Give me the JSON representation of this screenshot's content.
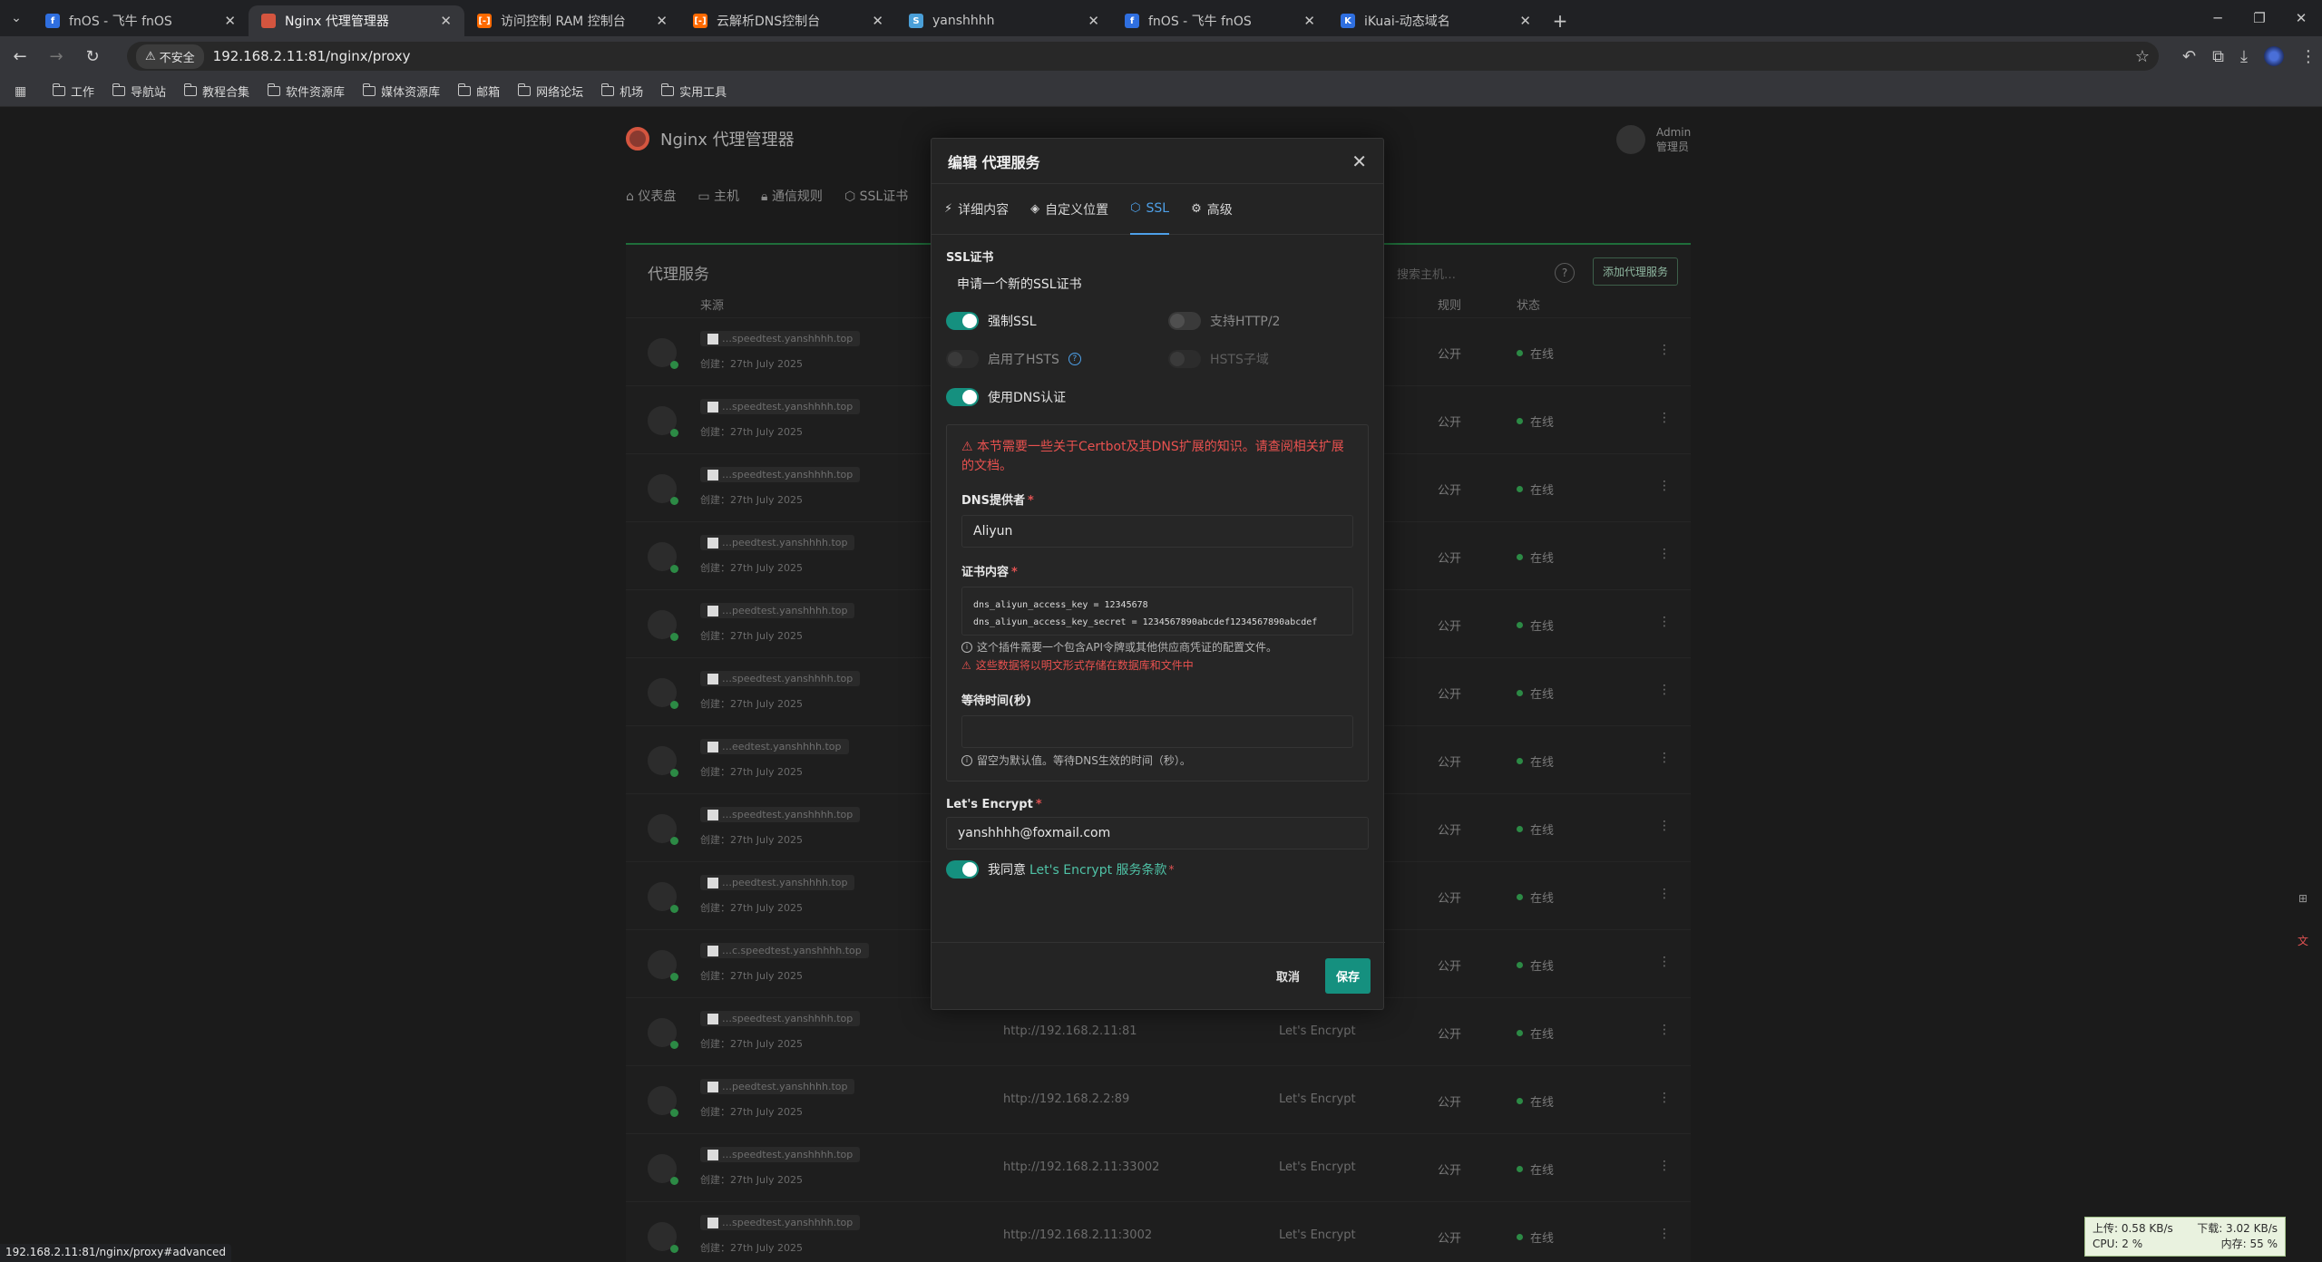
{
  "browser": {
    "tabs": [
      {
        "title": "fnOS - 飞牛 fnOS",
        "fav_color": "#2f6fe0",
        "fav": "f",
        "active": false
      },
      {
        "title": "Nginx 代理管理器",
        "fav_color": "#d4553f",
        "fav": "",
        "active": true
      },
      {
        "title": "访问控制 RAM 控制台",
        "fav_color": "#ff6a00",
        "fav": "[-]",
        "active": false
      },
      {
        "title": "云解析DNS控制台",
        "fav_color": "#ff6a00",
        "fav": "[-]",
        "active": false
      },
      {
        "title": "yanshhhh",
        "fav_color": "#4a9fd8",
        "fav": "S",
        "active": false
      },
      {
        "title": "fnOS - 飞牛 fnOS",
        "fav_color": "#2f6fe0",
        "fav": "f",
        "active": false
      },
      {
        "title": "iKuai-动态域名",
        "fav_color": "#2f6fe0",
        "fav": "K",
        "active": false
      }
    ],
    "insecure_label": "不安全",
    "url": "192.168.2.11:81/nginx/proxy",
    "bookmarks": [
      "工作",
      "导航站",
      "教程合集",
      "软件资源库",
      "媒体资源库",
      "邮箱",
      "网络论坛",
      "机场",
      "实用工具"
    ],
    "status_url": "192.168.2.11:81/nginx/proxy#advanced"
  },
  "app": {
    "title": "Nginx 代理管理器",
    "admin_name": "Admin",
    "admin_role": "管理员",
    "nav": [
      "仪表盘",
      "主机",
      "通信规则",
      "SSL证书"
    ],
    "card_title": "代理服务",
    "search_placeholder": "搜索主机…",
    "add_button": "添加代理服务",
    "col_source": "来源",
    "col_rule": "规则",
    "col_status": "状态"
  },
  "rows": [
    {
      "host": "…speedtest.yanshhhh.top",
      "created": "创建：27th July 2025",
      "dest": "",
      "ssl": "",
      "rule": "公开",
      "status": "在线"
    },
    {
      "host": "…speedtest.yanshhhh.top",
      "created": "创建：27th July 2025",
      "dest": "",
      "ssl": "",
      "rule": "公开",
      "status": "在线"
    },
    {
      "host": "…speedtest.yanshhhh.top",
      "created": "创建：27th July 2025",
      "dest": "",
      "ssl": "",
      "rule": "公开",
      "status": "在线"
    },
    {
      "host": "…peedtest.yanshhhh.top",
      "created": "创建：27th July 2025",
      "dest": "",
      "ssl": "",
      "rule": "公开",
      "status": "在线"
    },
    {
      "host": "…peedtest.yanshhhh.top",
      "created": "创建：27th July 2025",
      "dest": "",
      "ssl": "",
      "rule": "公开",
      "status": "在线"
    },
    {
      "host": "…speedtest.yanshhhh.top",
      "created": "创建：27th July 2025",
      "dest": "",
      "ssl": "",
      "rule": "公开",
      "status": "在线"
    },
    {
      "host": "…eedtest.yanshhhh.top",
      "created": "创建：27th July 2025",
      "dest": "",
      "ssl": "",
      "rule": "公开",
      "status": "在线"
    },
    {
      "host": "…speedtest.yanshhhh.top",
      "created": "创建：27th July 2025",
      "dest": "",
      "ssl": "",
      "rule": "公开",
      "status": "在线"
    },
    {
      "host": "…peedtest.yanshhhh.top",
      "created": "创建：27th July 2025",
      "dest": "",
      "ssl": "",
      "rule": "公开",
      "status": "在线"
    },
    {
      "host": "…c.speedtest.yanshhhh.top",
      "created": "创建：27th July 2025",
      "dest": "",
      "ssl": "",
      "rule": "公开",
      "status": "在线"
    },
    {
      "host": "…speedtest.yanshhhh.top",
      "created": "创建：27th July 2025",
      "dest": "http://192.168.2.11:81",
      "ssl": "Let's Encrypt",
      "rule": "公开",
      "status": "在线"
    },
    {
      "host": "…peedtest.yanshhhh.top",
      "created": "创建：27th July 2025",
      "dest": "http://192.168.2.2:89",
      "ssl": "Let's Encrypt",
      "rule": "公开",
      "status": "在线"
    },
    {
      "host": "…speedtest.yanshhhh.top",
      "created": "创建：27th July 2025",
      "dest": "http://192.168.2.11:33002",
      "ssl": "Let's Encrypt",
      "rule": "公开",
      "status": "在线"
    },
    {
      "host": "…speedtest.yanshhhh.top",
      "created": "创建：27th July 2025",
      "dest": "http://192.168.2.11:3002",
      "ssl": "Let's Encrypt",
      "rule": "公开",
      "status": "在线"
    }
  ],
  "modal": {
    "title": "编辑 代理服务",
    "tabs": [
      {
        "label": "详细内容",
        "icon": "⚡"
      },
      {
        "label": "自定义位置",
        "icon": "◈"
      },
      {
        "label": "SSL",
        "icon": "⬡"
      },
      {
        "label": "高级",
        "icon": "⚙"
      }
    ],
    "ssl_cert_label": "SSL证书",
    "ssl_cert_value": "申请一个新的SSL证书",
    "force_ssl": "强制SSL",
    "http2": "支持HTTP/2",
    "hsts": "启用了HSTS",
    "hsts_sub": "HSTS子域",
    "dns_challenge": "使用DNS认证",
    "dns_warning": "本节需要一些关于Certbot及其DNS扩展的知识。请查阅相关扩展的文档。",
    "dns_provider_label": "DNS提供者",
    "dns_provider_value": "Aliyun",
    "credentials_label": "证书内容",
    "credentials_line1": "dns_aliyun_access_key = 12345678",
    "credentials_line2": "dns_aliyun_access_key_secret = 1234567890abcdef1234567890abcdef",
    "credentials_hint": "这个插件需要一个包含API令牌或其他供应商凭证的配置文件。",
    "credentials_warn": "这些数据将以明文形式存储在数据库和文件中",
    "wait_label": "等待时间(秒)",
    "wait_value": "",
    "wait_hint": "留空为默认值。等待DNS生效的时间（秒）。",
    "le_label": "Let's Encrypt",
    "le_email": "yanshhhh@foxmail.com",
    "agree_prefix": "我同意",
    "agree_link": "Let's Encrypt 服务条款",
    "cancel": "取消",
    "save": "保存"
  },
  "netmon": {
    "up": "上传: 0.58 KB/s",
    "down": "下载: 3.02 KB/s",
    "cpu": "CPU: 2 %",
    "mem": "内存: 55 %"
  },
  "colors": {
    "accent": "#15907f",
    "ssl_tab": "#4ea0e8",
    "danger": "#e8514f",
    "online": "#2c8a45"
  }
}
